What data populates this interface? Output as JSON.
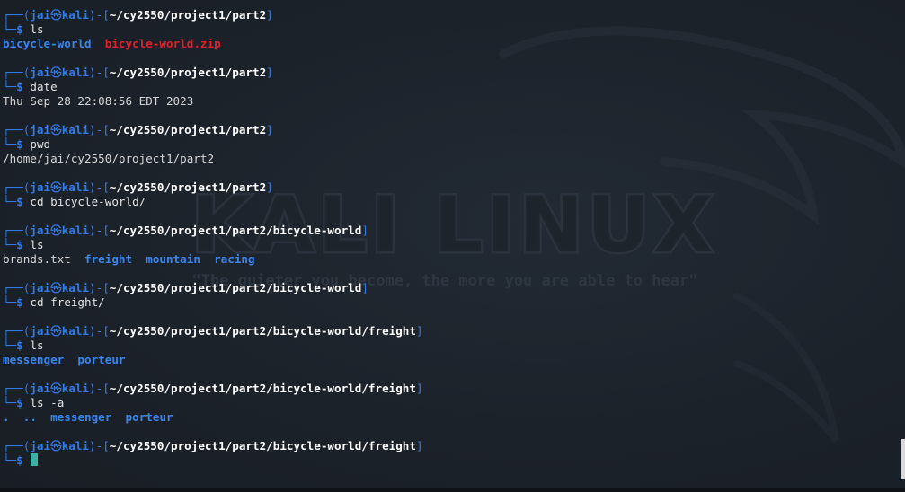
{
  "prompt": {
    "corner_top": "┌──(",
    "user": "jai",
    "skull": "㉿",
    "host": "kali",
    "mid": ")-[",
    "close": "]",
    "corner_bottom": "└─",
    "dollar": "$"
  },
  "wallpaper": {
    "logo_text": "KALI LINUX",
    "tagline": "\"The quieter you become, the more you are able to hear\""
  },
  "entries": [
    {
      "path": "~/cy2550/project1/part2",
      "command": "ls",
      "output": [
        [
          {
            "text": "bicycle-world",
            "type": "dir"
          },
          {
            "text": "bicycle-world.zip",
            "type": "archive"
          }
        ]
      ]
    },
    {
      "path": "~/cy2550/project1/part2",
      "command": "date",
      "output": [
        [
          {
            "text": "Thu Sep 28 22:08:56 EDT 2023",
            "type": "out"
          }
        ]
      ]
    },
    {
      "path": "~/cy2550/project1/part2",
      "command": "pwd",
      "output": [
        [
          {
            "text": "/home/jai/cy2550/project1/part2",
            "type": "out"
          }
        ]
      ]
    },
    {
      "path": "~/cy2550/project1/part2",
      "command": "cd bicycle-world/",
      "output": []
    },
    {
      "path": "~/cy2550/project1/part2/bicycle-world",
      "command": "ls",
      "output": [
        [
          {
            "text": "brands.txt",
            "type": "out"
          },
          {
            "text": "freight",
            "type": "dir"
          },
          {
            "text": "mountain",
            "type": "dir"
          },
          {
            "text": "racing",
            "type": "dir"
          }
        ]
      ]
    },
    {
      "path": "~/cy2550/project1/part2/bicycle-world",
      "command": "cd freight/",
      "output": []
    },
    {
      "path": "~/cy2550/project1/part2/bicycle-world/freight",
      "command": "ls",
      "output": [
        [
          {
            "text": "messenger",
            "type": "dir"
          },
          {
            "text": "porteur",
            "type": "dir"
          }
        ]
      ]
    },
    {
      "path": "~/cy2550/project1/part2/bicycle-world/freight",
      "command": "ls -a",
      "output": [
        [
          {
            "text": ".",
            "type": "dir"
          },
          {
            "text": "..",
            "type": "dir"
          },
          {
            "text": "messenger",
            "type": "dir"
          },
          {
            "text": "porteur",
            "type": "dir"
          }
        ]
      ]
    }
  ],
  "current": {
    "path": "~/cy2550/project1/part2/bicycle-world/freight",
    "command": ""
  },
  "colors": {
    "background": "#1c2129",
    "prompt_frame": "#2f7ce8",
    "directory": "#3a86ee",
    "archive": "#e0202a",
    "cursor": "#3fb2a6"
  }
}
